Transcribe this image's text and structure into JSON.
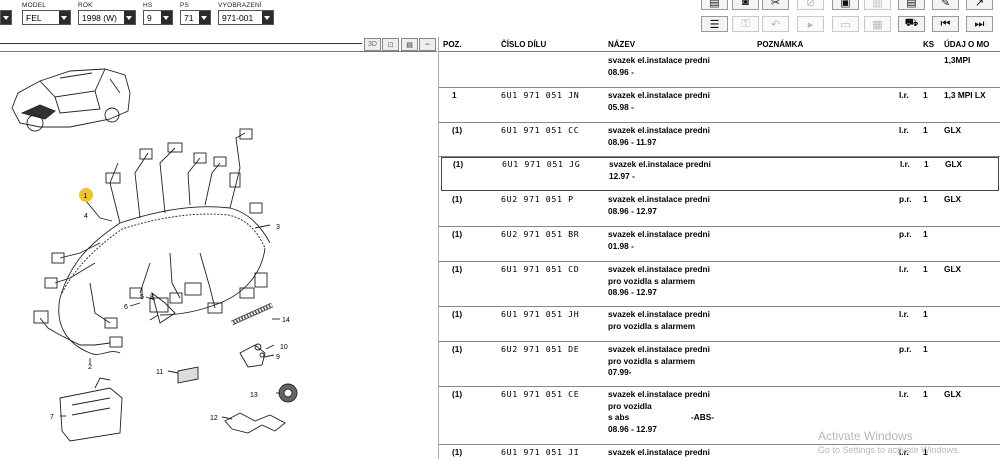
{
  "selectors": {
    "model": {
      "label": "MODEL",
      "value": "FEL"
    },
    "year": {
      "label": "ROK",
      "value": "1998 (W)"
    },
    "hs": {
      "label": "HS",
      "value": "9"
    },
    "ps": {
      "label": "PS",
      "value": "71"
    },
    "drawing": {
      "label": "VYOBRAZENÍ",
      "value": "971-001"
    }
  },
  "diagram": {
    "view_buttons": [
      "3D"
    ],
    "callouts": [
      "1",
      "2",
      "3",
      "4",
      "5",
      "6",
      "7",
      "8",
      "9",
      "10",
      "11",
      "12",
      "13",
      "14"
    ]
  },
  "table": {
    "headers": {
      "pos": "POZ.",
      "part_number": "ČÍSLO DÍLU",
      "name": "NÁZEV",
      "note": "POZNÁMKA",
      "qty": "KS",
      "data": "ÚDAJ O MO"
    },
    "rows": [
      {
        "pos": "",
        "part_number": "",
        "name": [
          "svazek el.instalace predni",
          "08.96 -"
        ],
        "abs": "",
        "type": "",
        "qty": "",
        "data": "1,3MPI"
      },
      {
        "pos": "1",
        "part_number": "6U1  971  051  JN",
        "name": [
          "svazek el.instalace predni",
          "05.98 -"
        ],
        "abs": "",
        "type": "l.r.",
        "qty": "1",
        "data": "1,3 MPI LX"
      },
      {
        "pos": "(1)",
        "part_number": "6U1  971  051  CC",
        "name": [
          "svazek el.instalace predni",
          "08.96 - 11.97"
        ],
        "abs": "",
        "type": "l.r.",
        "qty": "1",
        "data": "GLX"
      },
      {
        "pos": "(1)",
        "part_number": "6U1  971  051  JG",
        "name": [
          "svazek el.instalace predni",
          "12.97 -"
        ],
        "abs": "",
        "type": "l.r.",
        "qty": "1",
        "data": "GLX"
      },
      {
        "pos": "(1)",
        "part_number": "6U2  971  051  P",
        "name": [
          "svazek el.instalace predni",
          "08.96 - 12.97"
        ],
        "abs": "",
        "type": "p.r.",
        "qty": "1",
        "data": "GLX"
      },
      {
        "pos": "(1)",
        "part_number": "6U2  971  051  BR",
        "name": [
          "svazek el.instalace predni",
          "01.98 -"
        ],
        "abs": "",
        "type": "p.r.",
        "qty": "1",
        "data": ""
      },
      {
        "pos": "(1)",
        "part_number": "6U1  971  051  CD",
        "name": [
          "svazek el.instalace predni",
          "pro vozidla s alarmem",
          "08.96 - 12.97"
        ],
        "abs": "",
        "type": "l.r.",
        "qty": "1",
        "data": "GLX"
      },
      {
        "pos": "(1)",
        "part_number": "6U1  971  051  JH",
        "name": [
          "svazek el.instalace predni",
          "pro vozidla s alarmem"
        ],
        "abs": "",
        "type": "l.r.",
        "qty": "1",
        "data": ""
      },
      {
        "pos": "(1)",
        "part_number": "6U2  971  051  DE",
        "name": [
          "svazek el.instalace predni",
          "pro vozidla s alarmem",
          "07.99-"
        ],
        "abs": "",
        "type": "p.r.",
        "qty": "1",
        "data": ""
      },
      {
        "pos": "(1)",
        "part_number": "6U1  971  051  CE",
        "name": [
          "svazek el.instalace predni",
          "pro vozidla",
          "s  abs",
          "08.96 - 12.97"
        ],
        "abs": "-ABS-",
        "type": "l.r.",
        "qty": "1",
        "data": "GLX"
      },
      {
        "pos": "(1)",
        "part_number": "6U1  971  051  JI",
        "name": [
          "svazek el.instalace predni"
        ],
        "abs": "",
        "type": "l.r.",
        "qty": "1",
        "data": ""
      }
    ]
  },
  "watermark": {
    "line1": "Activate Windows",
    "line2": "Go to Settings to activate Windows."
  }
}
